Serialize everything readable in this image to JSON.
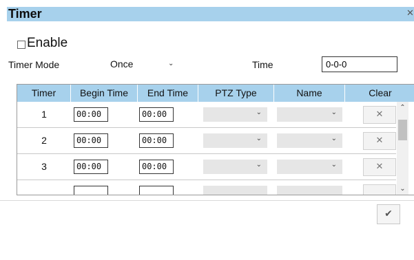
{
  "dialog": {
    "title": "Timer",
    "close_icon": "close-icon"
  },
  "enable": {
    "label": "Enable",
    "checked": false
  },
  "timer_mode": {
    "label": "Timer Mode",
    "value": "Once"
  },
  "time": {
    "label": "Time",
    "value": "0-0-0"
  },
  "table": {
    "headers": [
      "Timer",
      "Begin Time",
      "End Time",
      "PTZ Type",
      "Name",
      "Clear"
    ],
    "rows": [
      {
        "timer": "1",
        "begin": "00:00",
        "end": "00:00",
        "ptz_type": "",
        "name": ""
      },
      {
        "timer": "2",
        "begin": "00:00",
        "end": "00:00",
        "ptz_type": "",
        "name": ""
      },
      {
        "timer": "3",
        "begin": "00:00",
        "end": "00:00",
        "ptz_type": "",
        "name": ""
      }
    ]
  },
  "colors": {
    "header_bg": "#a7d1ec",
    "dropdown_bg": "#e6e6e6"
  }
}
